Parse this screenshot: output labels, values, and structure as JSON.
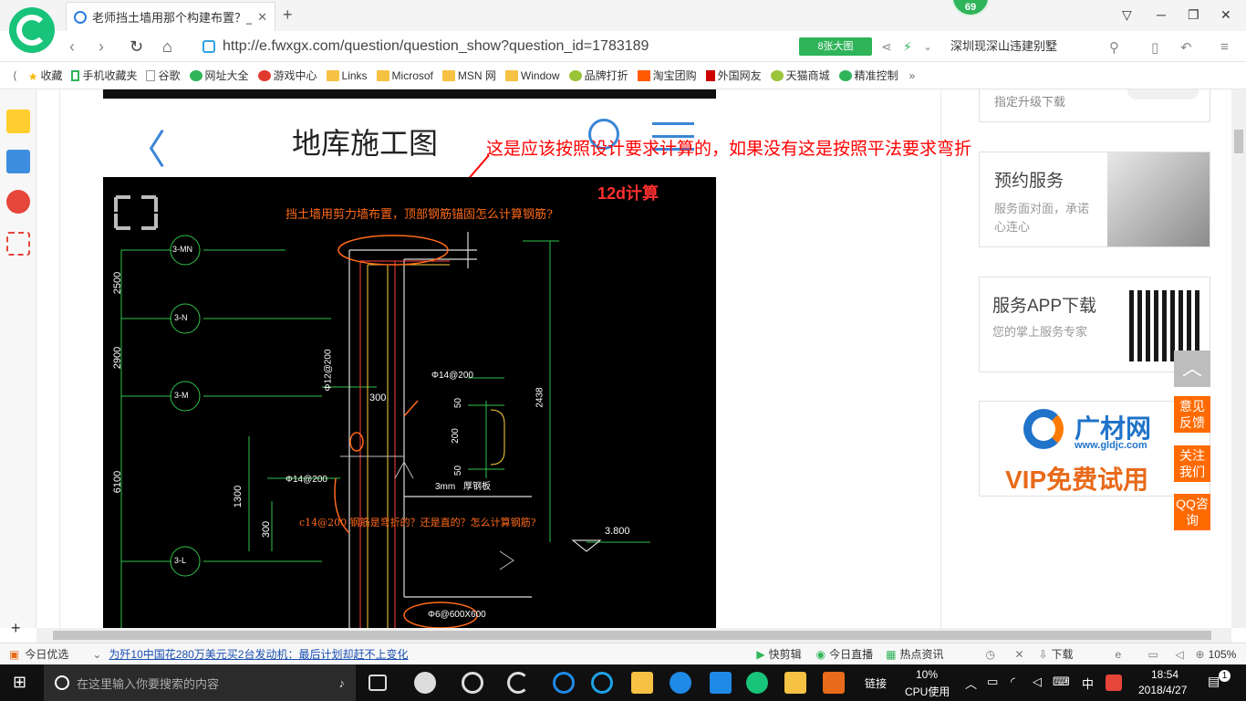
{
  "browser": {
    "tab_title": "老师挡土墙用那个构建布置？_广",
    "tab_close": "✕",
    "new_tab": "+",
    "badge": "69",
    "url": "http://e.fwxgx.com/question/question_show?question_id=1783189",
    "big_image_button": "8张大图",
    "search_text": "深圳现深山违建别墅"
  },
  "bookmarks": [
    {
      "label": "收藏",
      "icon": "star-icon"
    },
    {
      "label": "手机收藏夹",
      "icon": "phone-icon"
    },
    {
      "label": "谷歌",
      "icon": "page-icon"
    },
    {
      "label": "网址大全",
      "icon": "web-icon"
    },
    {
      "label": "游戏中心",
      "icon": "game-icon"
    },
    {
      "label": "Links",
      "icon": "folder-icon"
    },
    {
      "label": "Microsof",
      "icon": "folder-icon"
    },
    {
      "label": "MSN 网",
      "icon": "folder-icon"
    },
    {
      "label": "Window",
      "icon": "folder-icon"
    },
    {
      "label": "品牌打折",
      "icon": "leaf-icon"
    },
    {
      "label": "淘宝团购",
      "icon": "taobao-icon"
    },
    {
      "label": "外国网友",
      "icon": "bookmark-icon"
    },
    {
      "label": "天猫商城",
      "icon": "leaf-icon"
    },
    {
      "label": "精准控制",
      "icon": "chat-icon"
    }
  ],
  "page": {
    "title": "地库施工图",
    "annotation": "这是应该按照设计要求计算的，如果没有这是按照平法要求弯折",
    "cad": {
      "tag": "12d计算",
      "question_top": "挡土墙用剪力墙布置，顶部钢筋锚固怎么计算钢筋?",
      "question_mid": "c14@200 钢筋是弯折的？还是直的？怎么计算钢筋?",
      "axis_labels": [
        "3-MN",
        "3-N",
        "3-M",
        "3-L"
      ],
      "dims_left": [
        "2500",
        "2900",
        "6100",
        "1300",
        "300"
      ],
      "dim_300": "300",
      "dim_phi12": "Φ12@200",
      "dim_phi14_top": "Φ14@200",
      "dim_phi14_left": "Φ14@200",
      "dim_50a": "50",
      "dim_200": "200",
      "dim_50b": "50",
      "dim_2438": "2438",
      "dim_3mm": "3mm",
      "dim_steel": "厚钢板",
      "dim_3800": "3.800",
      "dim_bottom": "Φ6@600X600"
    }
  },
  "right": {
    "upgrade": "指定升级下载",
    "service_title": "预约服务",
    "service_desc": "服务面对面，承诺心连心",
    "app_title": "服务APP下载",
    "app_desc": "您的掌上服务专家",
    "ad_brand": "广材网",
    "ad_url": "www.gldjc.com",
    "ad_vip": "VIP免费试用"
  },
  "float_buttons": [
    "意见反馈",
    "关注我们",
    "QQ咨询"
  ],
  "statusbar": {
    "today": "今日优选",
    "news": "为歼10中国花280万美元买2台发动机：最后计划却赶不上变化",
    "kuaijianji": "快剪辑",
    "live": "今日直播",
    "hotnews": "热点资讯",
    "download": "下载",
    "zoom": "105%"
  },
  "taskbar": {
    "search_placeholder": "在这里输入你要搜索的内容",
    "link": "链接",
    "cpu": "10%",
    "cpu_label": "CPU使用",
    "ime": "中",
    "time": "18:54",
    "date": "2018/4/27",
    "notifications": "1"
  },
  "colors": {
    "accent_green": "#2fb45a",
    "annotation_red": "#ff0000",
    "cad_orange": "#ff6a1a",
    "float_orange": "#ff6a00"
  }
}
